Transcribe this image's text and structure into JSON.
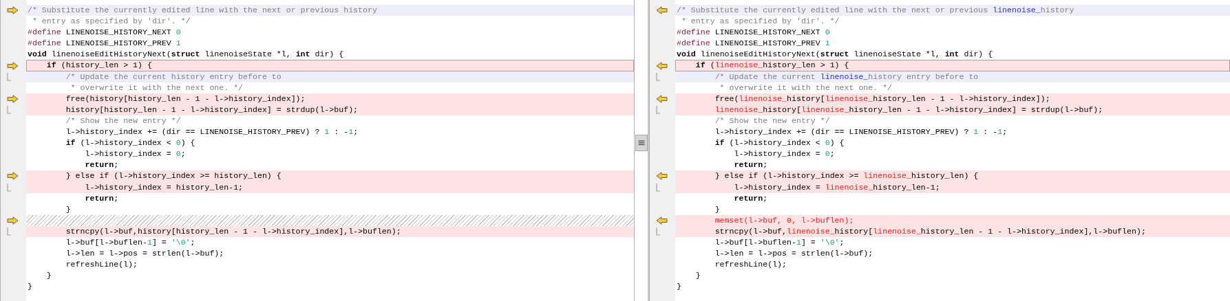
{
  "panes": [
    {
      "lines": [
        {
          "kind": "code",
          "changed": false,
          "minor": true,
          "current": false,
          "block_start": true,
          "block_continue": false,
          "tokens": [
            {
              "text": "/* Substitute the currently edited line with the next or previous history",
              "kind": "comment"
            }
          ]
        },
        {
          "kind": "code",
          "changed": false,
          "minor": false,
          "current": false,
          "block_start": false,
          "block_continue": false,
          "tokens": [
            {
              "text": " * entry as specified by 'dir'. */",
              "kind": "comment"
            }
          ]
        },
        {
          "kind": "code",
          "changed": false,
          "minor": false,
          "current": false,
          "block_start": false,
          "block_continue": false,
          "tokens": [
            {
              "text": "#define",
              "kind": "directive"
            },
            {
              "text": " LINENOISE_HISTORY_NEXT ",
              "kind": "plain"
            },
            {
              "text": "0",
              "kind": "number"
            }
          ]
        },
        {
          "kind": "code",
          "changed": false,
          "minor": false,
          "current": false,
          "block_start": false,
          "block_continue": false,
          "tokens": [
            {
              "text": "#define",
              "kind": "directive"
            },
            {
              "text": " LINENOISE_HISTORY_PREV ",
              "kind": "plain"
            },
            {
              "text": "1",
              "kind": "number"
            }
          ]
        },
        {
          "kind": "code",
          "changed": false,
          "minor": false,
          "current": false,
          "block_start": false,
          "block_continue": false,
          "tokens": [
            {
              "text": "void",
              "kind": "keyword"
            },
            {
              "text": " linenoiseEditHistoryNext(",
              "kind": "plain"
            },
            {
              "text": "struct",
              "kind": "keyword"
            },
            {
              "text": " linenoiseState *l, ",
              "kind": "plain"
            },
            {
              "text": "int",
              "kind": "keyword"
            },
            {
              "text": " dir) {",
              "kind": "plain"
            }
          ]
        },
        {
          "kind": "code",
          "changed": true,
          "minor": false,
          "current": true,
          "block_start": true,
          "block_continue": false,
          "tokens": [
            {
              "text": "    if",
              "kind": "keyword"
            },
            {
              "text": " (history_len > 1) {",
              "kind": "plain"
            }
          ]
        },
        {
          "kind": "code",
          "changed": false,
          "minor": true,
          "current": false,
          "block_start": false,
          "block_continue": true,
          "tokens": [
            {
              "text": "        /* Update the current history entry before to",
              "kind": "comment"
            }
          ]
        },
        {
          "kind": "code",
          "changed": false,
          "minor": false,
          "current": false,
          "block_start": false,
          "block_continue": false,
          "tokens": [
            {
              "text": "         * overwrite it with the next one. */",
              "kind": "comment"
            }
          ]
        },
        {
          "kind": "code",
          "changed": true,
          "minor": false,
          "current": false,
          "block_start": true,
          "block_continue": false,
          "tokens": [
            {
              "text": "        free(history[history_len - 1 - l->history_index]);",
              "kind": "plain"
            }
          ]
        },
        {
          "kind": "code",
          "changed": true,
          "minor": false,
          "current": false,
          "block_start": false,
          "block_continue": true,
          "tokens": [
            {
              "text": "        history[history_len - 1 - l->history_index] = strdup(l->buf);",
              "kind": "plain"
            }
          ]
        },
        {
          "kind": "code",
          "changed": false,
          "minor": false,
          "current": false,
          "block_start": false,
          "block_continue": false,
          "tokens": [
            {
              "text": "        /* Show the new entry */",
              "kind": "comment"
            }
          ]
        },
        {
          "kind": "code",
          "changed": false,
          "minor": false,
          "current": false,
          "block_start": false,
          "block_continue": false,
          "tokens": [
            {
              "text": "        l->history_index += (dir == LINENOISE_HISTORY_PREV) ? ",
              "kind": "plain"
            },
            {
              "text": "1",
              "kind": "number"
            },
            {
              "text": " : -",
              "kind": "plain"
            },
            {
              "text": "1",
              "kind": "number"
            },
            {
              "text": ";",
              "kind": "plain"
            }
          ]
        },
        {
          "kind": "code",
          "changed": false,
          "minor": false,
          "current": false,
          "block_start": false,
          "block_continue": false,
          "tokens": [
            {
              "text": "        if",
              "kind": "keyword"
            },
            {
              "text": " (l->history_index < ",
              "kind": "plain"
            },
            {
              "text": "0",
              "kind": "number"
            },
            {
              "text": ") {",
              "kind": "plain"
            }
          ]
        },
        {
          "kind": "code",
          "changed": false,
          "minor": false,
          "current": false,
          "block_start": false,
          "block_continue": false,
          "tokens": [
            {
              "text": "            l->history_index = ",
              "kind": "plain"
            },
            {
              "text": "0",
              "kind": "number"
            },
            {
              "text": ";",
              "kind": "plain"
            }
          ]
        },
        {
          "kind": "code",
          "changed": false,
          "minor": false,
          "current": false,
          "block_start": false,
          "block_continue": false,
          "tokens": [
            {
              "text": "            return",
              "kind": "keyword"
            },
            {
              "text": ";",
              "kind": "plain"
            }
          ]
        },
        {
          "kind": "code",
          "changed": true,
          "minor": false,
          "current": false,
          "block_start": true,
          "block_continue": false,
          "tokens": [
            {
              "text": "        } else if (l->history_index >= history_len) {",
              "kind": "plain"
            }
          ]
        },
        {
          "kind": "code",
          "changed": true,
          "minor": false,
          "current": false,
          "block_start": false,
          "block_continue": true,
          "tokens": [
            {
              "text": "            l->history_index = history_len-1;",
              "kind": "plain"
            }
          ]
        },
        {
          "kind": "code",
          "changed": false,
          "minor": false,
          "current": false,
          "block_start": false,
          "block_continue": false,
          "tokens": [
            {
              "text": "            return",
              "kind": "keyword"
            },
            {
              "text": ";",
              "kind": "plain"
            }
          ]
        },
        {
          "kind": "code",
          "changed": false,
          "minor": false,
          "current": false,
          "block_start": false,
          "block_continue": false,
          "tokens": [
            {
              "text": "        }",
              "kind": "plain"
            }
          ]
        },
        {
          "kind": "gap",
          "current": false,
          "block_start": true,
          "block_continue": false
        },
        {
          "kind": "code",
          "changed": true,
          "minor": false,
          "current": false,
          "block_start": false,
          "block_continue": true,
          "tokens": [
            {
              "text": "        strncpy(l->buf,history[history_len - 1 - l->history_index],l->buflen);",
              "kind": "plain"
            }
          ]
        },
        {
          "kind": "code",
          "changed": false,
          "minor": false,
          "current": false,
          "block_start": false,
          "block_continue": false,
          "tokens": [
            {
              "text": "        l->buf[l->buflen-",
              "kind": "plain"
            },
            {
              "text": "1",
              "kind": "number"
            },
            {
              "text": "] = ",
              "kind": "plain"
            },
            {
              "text": "'\\0'",
              "kind": "number"
            },
            {
              "text": ";",
              "kind": "plain"
            }
          ]
        },
        {
          "kind": "code",
          "changed": false,
          "minor": false,
          "current": false,
          "block_start": false,
          "block_continue": false,
          "tokens": [
            {
              "text": "        l->len = l->pos = strlen(l->buf);",
              "kind": "plain"
            }
          ]
        },
        {
          "kind": "code",
          "changed": false,
          "minor": false,
          "current": false,
          "block_start": false,
          "block_continue": false,
          "tokens": [
            {
              "text": "        refreshLine(l);",
              "kind": "plain"
            }
          ]
        },
        {
          "kind": "code",
          "changed": false,
          "minor": false,
          "current": false,
          "block_start": false,
          "block_continue": false,
          "tokens": [
            {
              "text": "    }",
              "kind": "plain"
            }
          ]
        },
        {
          "kind": "code",
          "changed": false,
          "minor": false,
          "current": false,
          "block_start": false,
          "block_continue": false,
          "tokens": [
            {
              "text": "}",
              "kind": "plain"
            }
          ]
        }
      ]
    },
    {
      "lines": [
        {
          "kind": "code",
          "changed": false,
          "minor": true,
          "current": false,
          "block_start": true,
          "block_continue": false,
          "tokens": [
            {
              "text": "/* Substitute the currently edited line with the next or previous ",
              "kind": "comment"
            },
            {
              "text": "linenoise_",
              "kind": "diff_comment"
            },
            {
              "text": "history",
              "kind": "comment"
            }
          ]
        },
        {
          "kind": "code",
          "changed": false,
          "minor": false,
          "current": false,
          "block_start": false,
          "block_continue": false,
          "tokens": [
            {
              "text": " * entry as specified by 'dir'. */",
              "kind": "comment"
            }
          ]
        },
        {
          "kind": "code",
          "changed": false,
          "minor": false,
          "current": false,
          "block_start": false,
          "block_continue": false,
          "tokens": [
            {
              "text": "#define",
              "kind": "directive"
            },
            {
              "text": " LINENOISE_HISTORY_NEXT ",
              "kind": "plain"
            },
            {
              "text": "0",
              "kind": "number"
            }
          ]
        },
        {
          "kind": "code",
          "changed": false,
          "minor": false,
          "current": false,
          "block_start": false,
          "block_continue": false,
          "tokens": [
            {
              "text": "#define",
              "kind": "directive"
            },
            {
              "text": " LINENOISE_HISTORY_PREV ",
              "kind": "plain"
            },
            {
              "text": "1",
              "kind": "number"
            }
          ]
        },
        {
          "kind": "code",
          "changed": false,
          "minor": false,
          "current": false,
          "block_start": false,
          "block_continue": false,
          "tokens": [
            {
              "text": "void",
              "kind": "keyword"
            },
            {
              "text": " linenoiseEditHistoryNext(",
              "kind": "plain"
            },
            {
              "text": "struct",
              "kind": "keyword"
            },
            {
              "text": " linenoiseState *l, ",
              "kind": "plain"
            },
            {
              "text": "int",
              "kind": "keyword"
            },
            {
              "text": " dir) {",
              "kind": "plain"
            }
          ]
        },
        {
          "kind": "code",
          "changed": true,
          "minor": false,
          "current": true,
          "block_start": true,
          "block_continue": false,
          "tokens": [
            {
              "text": "    if",
              "kind": "keyword"
            },
            {
              "text": " (",
              "kind": "plain"
            },
            {
              "text": "linenoise_",
              "kind": "diff"
            },
            {
              "text": "history_len > 1) {",
              "kind": "plain"
            }
          ]
        },
        {
          "kind": "code",
          "changed": false,
          "minor": true,
          "current": false,
          "block_start": false,
          "block_continue": true,
          "tokens": [
            {
              "text": "        /* Update the current ",
              "kind": "comment"
            },
            {
              "text": "linenoise_",
              "kind": "diff_comment"
            },
            {
              "text": "history entry before to",
              "kind": "comment"
            }
          ]
        },
        {
          "kind": "code",
          "changed": false,
          "minor": false,
          "current": false,
          "block_start": false,
          "block_continue": false,
          "tokens": [
            {
              "text": "         * overwrite it with the next one. */",
              "kind": "comment"
            }
          ]
        },
        {
          "kind": "code",
          "changed": true,
          "minor": false,
          "current": false,
          "block_start": true,
          "block_continue": false,
          "tokens": [
            {
              "text": "        free(",
              "kind": "plain"
            },
            {
              "text": "linenoise_",
              "kind": "diff"
            },
            {
              "text": "history[",
              "kind": "plain"
            },
            {
              "text": "linenoise_",
              "kind": "diff"
            },
            {
              "text": "history_len - 1 - l->history_index]);",
              "kind": "plain"
            }
          ]
        },
        {
          "kind": "code",
          "changed": true,
          "minor": false,
          "current": false,
          "block_start": false,
          "block_continue": true,
          "tokens": [
            {
              "text": "        linenoise_",
              "kind": "diff"
            },
            {
              "text": "history[",
              "kind": "plain"
            },
            {
              "text": "linenoise_",
              "kind": "diff"
            },
            {
              "text": "history_len - 1 - l->history_index] = strdup(l->buf);",
              "kind": "plain"
            }
          ]
        },
        {
          "kind": "code",
          "changed": false,
          "minor": false,
          "current": false,
          "block_start": false,
          "block_continue": false,
          "tokens": [
            {
              "text": "        /* Show the new entry */",
              "kind": "comment"
            }
          ]
        },
        {
          "kind": "code",
          "changed": false,
          "minor": false,
          "current": false,
          "block_start": false,
          "block_continue": false,
          "tokens": [
            {
              "text": "        l->history_index += (dir == LINENOISE_HISTORY_PREV) ? ",
              "kind": "plain"
            },
            {
              "text": "1",
              "kind": "number"
            },
            {
              "text": " : -",
              "kind": "plain"
            },
            {
              "text": "1",
              "kind": "number"
            },
            {
              "text": ";",
              "kind": "plain"
            }
          ]
        },
        {
          "kind": "code",
          "changed": false,
          "minor": false,
          "current": false,
          "block_start": false,
          "block_continue": false,
          "tokens": [
            {
              "text": "        if",
              "kind": "keyword"
            },
            {
              "text": " (l->history_index < ",
              "kind": "plain"
            },
            {
              "text": "0",
              "kind": "number"
            },
            {
              "text": ") {",
              "kind": "plain"
            }
          ]
        },
        {
          "kind": "code",
          "changed": false,
          "minor": false,
          "current": false,
          "block_start": false,
          "block_continue": false,
          "tokens": [
            {
              "text": "            l->history_index = ",
              "kind": "plain"
            },
            {
              "text": "0",
              "kind": "number"
            },
            {
              "text": ";",
              "kind": "plain"
            }
          ]
        },
        {
          "kind": "code",
          "changed": false,
          "minor": false,
          "current": false,
          "block_start": false,
          "block_continue": false,
          "tokens": [
            {
              "text": "            return",
              "kind": "keyword"
            },
            {
              "text": ";",
              "kind": "plain"
            }
          ]
        },
        {
          "kind": "code",
          "changed": true,
          "minor": false,
          "current": false,
          "block_start": true,
          "block_continue": false,
          "tokens": [
            {
              "text": "        } else if (l->history_index >= ",
              "kind": "plain"
            },
            {
              "text": "linenoise_",
              "kind": "diff"
            },
            {
              "text": "history_len) {",
              "kind": "plain"
            }
          ]
        },
        {
          "kind": "code",
          "changed": true,
          "minor": false,
          "current": false,
          "block_start": false,
          "block_continue": true,
          "tokens": [
            {
              "text": "            l->history_index = ",
              "kind": "plain"
            },
            {
              "text": "linenoise_",
              "kind": "diff"
            },
            {
              "text": "history_len-1;",
              "kind": "plain"
            }
          ]
        },
        {
          "kind": "code",
          "changed": false,
          "minor": false,
          "current": false,
          "block_start": false,
          "block_continue": false,
          "tokens": [
            {
              "text": "            return",
              "kind": "keyword"
            },
            {
              "text": ";",
              "kind": "plain"
            }
          ]
        },
        {
          "kind": "code",
          "changed": false,
          "minor": false,
          "current": false,
          "block_start": false,
          "block_continue": false,
          "tokens": [
            {
              "text": "        }",
              "kind": "plain"
            }
          ]
        },
        {
          "kind": "code",
          "changed": true,
          "minor": false,
          "current": false,
          "block_start": true,
          "block_continue": false,
          "tokens": [
            {
              "text": "        memset(l->buf, 0, l->buflen);",
              "kind": "diff"
            }
          ]
        },
        {
          "kind": "code",
          "changed": true,
          "minor": false,
          "current": false,
          "block_start": false,
          "block_continue": true,
          "tokens": [
            {
              "text": "        strncpy(l->buf,",
              "kind": "plain"
            },
            {
              "text": "linenoise_",
              "kind": "diff"
            },
            {
              "text": "history[",
              "kind": "plain"
            },
            {
              "text": "linenoise_",
              "kind": "diff"
            },
            {
              "text": "history_len - 1 - l->history_index],l->buflen);",
              "kind": "plain"
            }
          ]
        },
        {
          "kind": "code",
          "changed": false,
          "minor": false,
          "current": false,
          "block_start": false,
          "block_continue": false,
          "tokens": [
            {
              "text": "        l->buf[l->buflen-",
              "kind": "plain"
            },
            {
              "text": "1",
              "kind": "number"
            },
            {
              "text": "] = ",
              "kind": "plain"
            },
            {
              "text": "'\\0'",
              "kind": "number"
            },
            {
              "text": ";",
              "kind": "plain"
            }
          ]
        },
        {
          "kind": "code",
          "changed": false,
          "minor": false,
          "current": false,
          "block_start": false,
          "block_continue": false,
          "tokens": [
            {
              "text": "        l->len = l->pos = strlen(l->buf);",
              "kind": "plain"
            }
          ]
        },
        {
          "kind": "code",
          "changed": false,
          "minor": false,
          "current": false,
          "block_start": false,
          "block_continue": false,
          "tokens": [
            {
              "text": "        refreshLine(l);",
              "kind": "plain"
            }
          ]
        },
        {
          "kind": "code",
          "changed": false,
          "minor": false,
          "current": false,
          "block_start": false,
          "block_continue": false,
          "tokens": [
            {
              "text": "    }",
              "kind": "plain"
            }
          ]
        },
        {
          "kind": "code",
          "changed": false,
          "minor": false,
          "current": false,
          "block_start": false,
          "block_continue": false,
          "tokens": [
            {
              "text": "}",
              "kind": "plain"
            }
          ]
        }
      ]
    }
  ]
}
